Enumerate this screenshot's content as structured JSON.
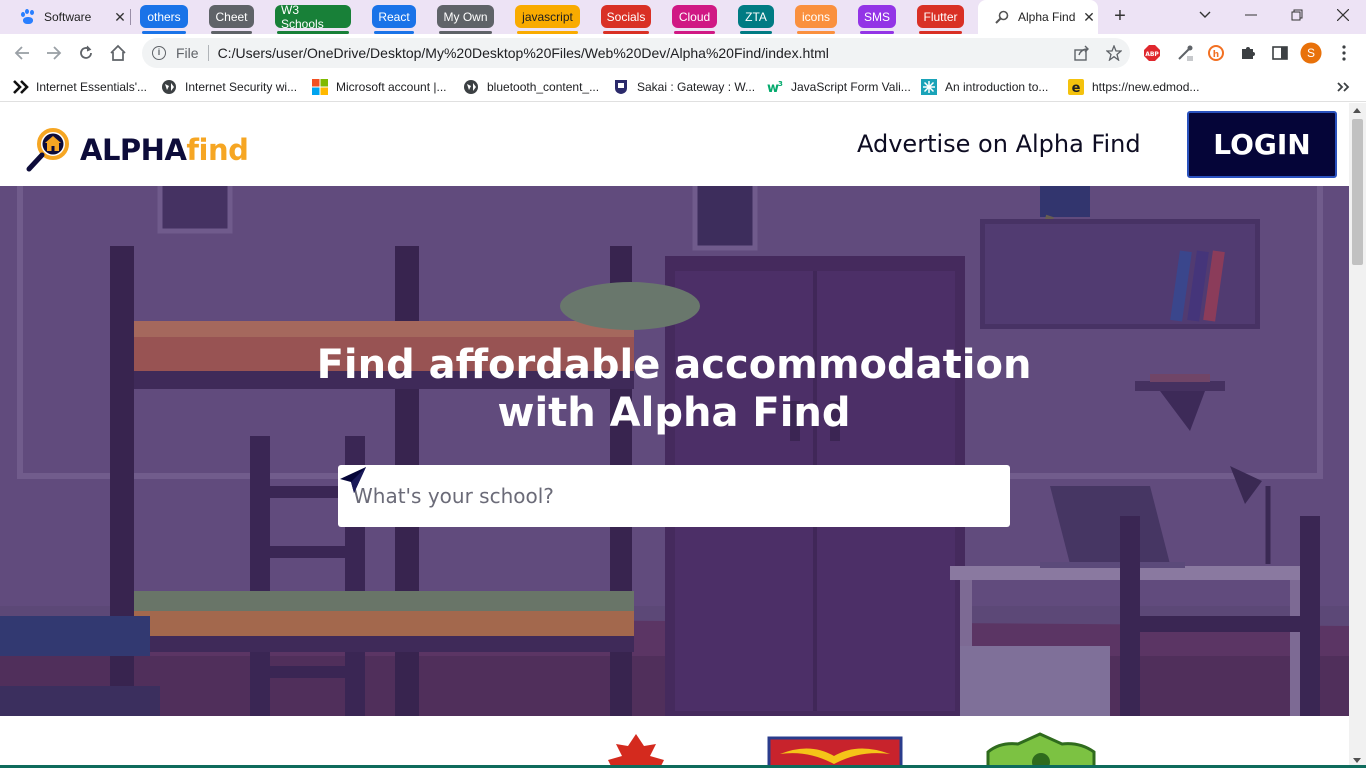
{
  "browser": {
    "tabs": [
      {
        "label": "Software"
      },
      {
        "label": "Alpha Find"
      }
    ],
    "tab_groups": [
      {
        "label": "others",
        "color": "#1a73e8"
      },
      {
        "label": "Cheet",
        "color": "#5f6368"
      },
      {
        "label": "W3 Schools",
        "color": "#188038"
      },
      {
        "label": "React",
        "color": "#1a73e8"
      },
      {
        "label": "My Own",
        "color": "#5f6368"
      },
      {
        "label": "javascript",
        "color": "#f9ab00"
      },
      {
        "label": "Socials",
        "color": "#d93025"
      },
      {
        "label": "Cloud",
        "color": "#d01884"
      },
      {
        "label": "ZTA",
        "color": "#007b83"
      },
      {
        "label": "icons",
        "color": "#fa903e"
      },
      {
        "label": "SMS",
        "color": "#9334e6"
      },
      {
        "label": "Flutter",
        "color": "#d93025"
      }
    ],
    "url_scheme": "File",
    "url": "C:/Users/user/OneDrive/Desktop/My%20Desktop%20Files/Web%20Dev/Alpha%20Find/index.html",
    "profile_initial": "S",
    "bookmarks": [
      {
        "label": "Internet Essentials'..."
      },
      {
        "label": "Internet Security wi..."
      },
      {
        "label": "Microsoft account |..."
      },
      {
        "label": "bluetooth_content_..."
      },
      {
        "label": "Sakai : Gateway : W..."
      },
      {
        "label": "JavaScript Form Vali..."
      },
      {
        "label": "An introduction to..."
      },
      {
        "label": "https://new.edmod..."
      }
    ]
  },
  "site": {
    "logo_part1": "ALPHA",
    "logo_part2": "find",
    "nav_advertise": "Advertise on Alpha Find",
    "login_label": "LOGIN",
    "hero_line1": "Find affordable accommodation",
    "hero_line2": "with Alpha Find",
    "search_placeholder": "What's your school?",
    "brand_navy": "#050538",
    "brand_orange": "#f6a623"
  }
}
